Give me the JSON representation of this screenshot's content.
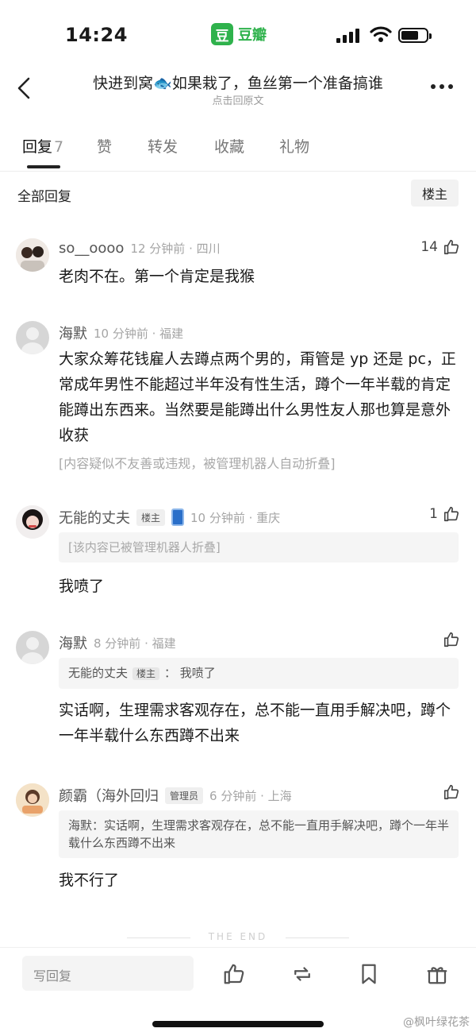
{
  "status_bar": {
    "time": "14:24",
    "app_logo_char": "豆",
    "app_name": "豆瓣"
  },
  "header": {
    "title": "快进到窝🐟如果栽了，鱼丝第一个准备搞谁",
    "subtitle": "点击回原文"
  },
  "tabs": [
    {
      "label": "回复",
      "count": "7",
      "active": true
    },
    {
      "label": "赞"
    },
    {
      "label": "转发"
    },
    {
      "label": "收藏"
    },
    {
      "label": "礼物"
    }
  ],
  "filter": {
    "all_label": "全部回复",
    "op_label": "楼主"
  },
  "comments": [
    {
      "username": "so__oooo",
      "time": "12 分钟前 · 四川",
      "likes": "14",
      "text": "老肉不在。第一个肯定是我猴"
    },
    {
      "username": "海默",
      "time": "10 分钟前 · 福建",
      "text": "大家众筹花钱雇人去蹲点两个男的，甭管是 yp 还是 pc，正常成年男性不能超过半年没有性生活，蹲个一年半载的肯定能蹲出东西来。当然要是能蹲出什么男性友人那也算是意外收获",
      "folded_note": "[内容疑似不友善或违规，被管理机器人自动折叠]"
    },
    {
      "username": "无能的丈夫",
      "tag": "楼主",
      "time": "10 分钟前 · 重庆",
      "likes": "1",
      "quote": "[该内容已被管理机器人折叠]",
      "text": "我喷了"
    },
    {
      "username": "海默",
      "time": "8 分钟前 · 福建",
      "quote_user": "无能的丈夫",
      "quote_tag": "楼主",
      "quote_text": "：  我喷了",
      "text": "实话啊，生理需求客观存在，总不能一直用手解决吧，蹲个一年半载什么东西蹲不出来"
    },
    {
      "username": "颜霸（海外回归",
      "tag": "管理员",
      "time": "6 分钟前 · 上海",
      "quote": "海默：实话啊，生理需求客观存在，总不能一直用手解决吧，蹲个一年半载什么东西蹲不出来",
      "text": "我不行了"
    }
  ],
  "end_label": "THE END",
  "bottom_bar": {
    "reply_placeholder": "写回复"
  },
  "watermark": "@枫叶绿花茶",
  "colors": {
    "douban_green": "#2fb24c",
    "text_primary": "#1a1a1a",
    "text_muted": "#a5a5a5"
  }
}
